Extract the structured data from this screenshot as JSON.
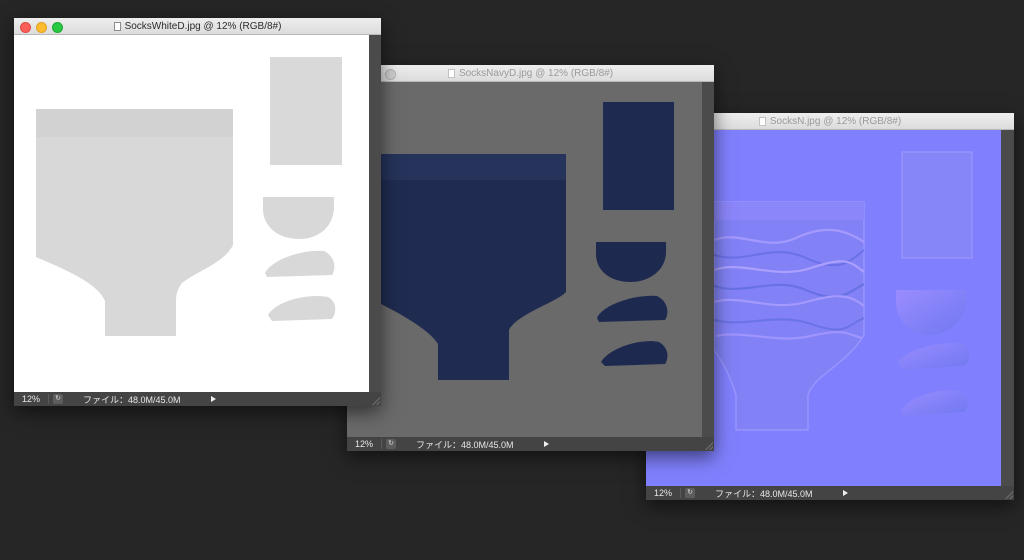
{
  "windows": [
    {
      "id": "white",
      "title": "SocksWhiteD.jpg @ 12% (RGB/8#)",
      "active": true,
      "zoom": "12%",
      "file_info": "ファイル：48.0M/45.0M",
      "canvas_color": "#ffffff",
      "piece_color": "#d8d8d8"
    },
    {
      "id": "navy",
      "title": "SocksNavyD.jpg @ 12% (RGB/8#)",
      "active": false,
      "zoom": "12%",
      "file_info": "ファイル：48.0M/45.0M",
      "canvas_color": "#6a6a6a",
      "piece_color": "#1e2a4e"
    },
    {
      "id": "normal",
      "title": "SocksN.jpg @ 12% (RGB/8#)",
      "active": false,
      "zoom": "12%",
      "file_info": "ファイル：48.0M/45.0M",
      "canvas_color": "#8080fe",
      "piece_color": "#8585fa"
    }
  ],
  "icons": {
    "status_options": "circle-arrow-icon",
    "status_menu": "play-triangle-icon",
    "doc": "document-icon"
  }
}
